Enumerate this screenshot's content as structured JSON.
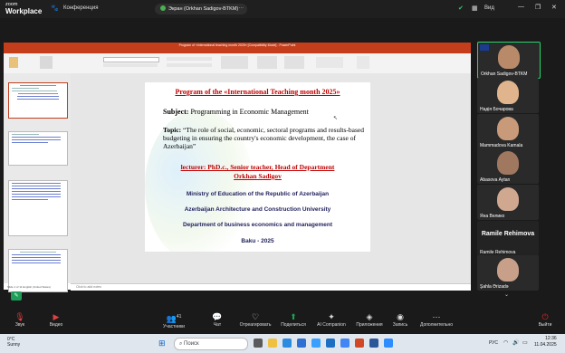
{
  "zoom": {
    "brand_top": "zoom",
    "brand_bottom": "Workplace",
    "conference_label": "Конференция",
    "share_label": "Экран (Orkhan Sadigov-BTKM)",
    "view_label": "Вид"
  },
  "ppt": {
    "title": "Program of «International teaching month 2025» [Compatibility Mode] - PowerPoint",
    "tabs": [
      "File",
      "Home",
      "Insert",
      "Design",
      "Transitions",
      "Animations",
      "Slide Show",
      "Review",
      "View",
      "Help"
    ],
    "notes_placeholder": "Click to add notes",
    "status_left": "Slide 1 of 11    English (United States)"
  },
  "slide": {
    "program_title": "Program of the «International Teaching month 2025»",
    "subject_label": "Subject:",
    "subject_value": " Programming in Economic Management",
    "topic_label": "Topic:",
    "topic_value": " “The role of social, economic, sectoral programs and results-based budgeting in ensuring the country's economic development, the case of Azerbaijan”",
    "lecturer_line1": "lecturer: PhD.c., Senior teacher, Head of Department",
    "lecturer_line2": "Orkhan Sadigov",
    "ministry": "Ministry of Education of the Republic of Azerbaijan",
    "university": "Azerbaijan Architecture and Construction University",
    "department": "Department of business economics and management",
    "city_year": "Baku  - 2025"
  },
  "participants": [
    {
      "name": "Orkhan Sadigov-BTKM",
      "color": "#b98a6a"
    },
    {
      "name": "Надія Бочарова",
      "color": "#e0b48c"
    },
    {
      "name": "Mammadova Kamala",
      "color": "#c89a7a"
    },
    {
      "name": "Abasova Aytan",
      "color": "#a07860"
    },
    {
      "name": "Яна Велико",
      "color": "#d0a890"
    },
    {
      "name": "Ramile Rehimova",
      "color": ""
    },
    {
      "name": "Şahla Ərizadə",
      "color": "#c8a08a"
    }
  ],
  "controls": [
    {
      "icon": "mic-off-icon",
      "label": "Звук"
    },
    {
      "icon": "video-off-icon",
      "label": "Видео"
    },
    {
      "icon": "participants-icon",
      "label": "Участники",
      "count": "41"
    },
    {
      "icon": "chat-icon",
      "label": "Чат"
    },
    {
      "icon": "react-icon",
      "label": "Отреагировать"
    },
    {
      "icon": "share-icon",
      "label": "Поделиться"
    },
    {
      "icon": "ai-icon",
      "label": "AI Companion"
    },
    {
      "icon": "apps-icon",
      "label": "Приложения"
    },
    {
      "icon": "record-icon",
      "label": "Запись"
    },
    {
      "icon": "more-icon",
      "label": "Дополнительно"
    },
    {
      "icon": "leave-icon",
      "label": "Выйти"
    }
  ],
  "taskbar": {
    "temp": "0°C",
    "weather": "Sunny",
    "search": "Поиск",
    "lang": "РУС",
    "time": "12:36",
    "date": "11.04.2025"
  },
  "colors": {
    "ppt_accent": "#c43e1c",
    "slide_red": "#c00000",
    "leave_red": "#e02828",
    "share_green": "#19a356"
  }
}
